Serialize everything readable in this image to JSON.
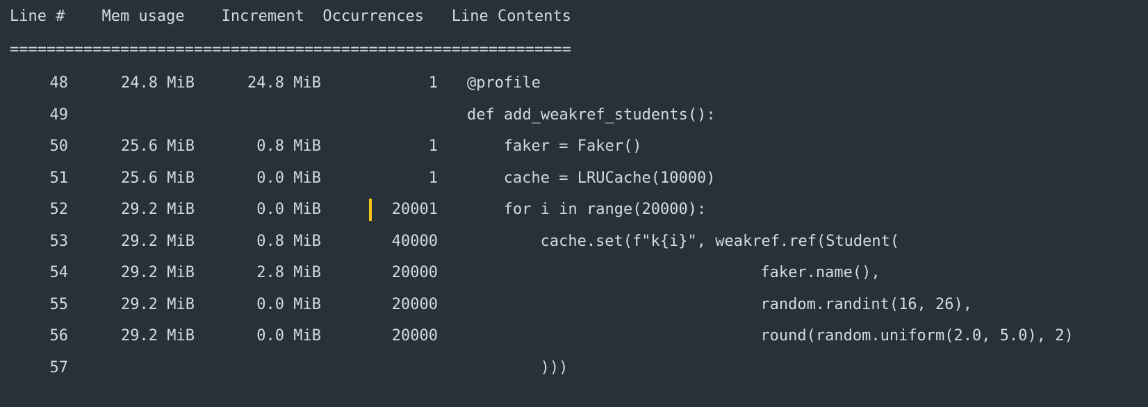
{
  "header": {
    "text": "Line #    Mem usage    Increment  Occurrences   Line Contents"
  },
  "separator": {
    "text": "============================================================="
  },
  "rows": [
    {
      "line": "48",
      "mem": "24.8 MiB",
      "inc": "24.8 MiB",
      "occ": "1",
      "code": "@profile",
      "indent": 0
    },
    {
      "line": "49",
      "mem": "",
      "inc": "",
      "occ": "",
      "code": "def add_weakref_students():",
      "indent": 0
    },
    {
      "line": "50",
      "mem": "25.6 MiB",
      "inc": "0.8 MiB",
      "occ": "1",
      "code": "faker = Faker()",
      "indent": 4
    },
    {
      "line": "51",
      "mem": "25.6 MiB",
      "inc": "0.0 MiB",
      "occ": "1",
      "code": "cache = LRUCache(10000)",
      "indent": 4
    },
    {
      "line": "52",
      "mem": "29.2 MiB",
      "inc": "0.0 MiB",
      "occ": "20001",
      "code": "for i in range(20000):",
      "indent": 4
    },
    {
      "line": "53",
      "mem": "29.2 MiB",
      "inc": "0.8 MiB",
      "occ": "40000",
      "code": "cache.set(f\"k{i}\", weakref.ref(Student(",
      "indent": 8
    },
    {
      "line": "54",
      "mem": "29.2 MiB",
      "inc": "2.8 MiB",
      "occ": "20000",
      "code": "faker.name(),",
      "indent": 32
    },
    {
      "line": "55",
      "mem": "29.2 MiB",
      "inc": "0.0 MiB",
      "occ": "20000",
      "code": "random.randint(16, 26),",
      "indent": 32
    },
    {
      "line": "56",
      "mem": "29.2 MiB",
      "inc": "0.0 MiB",
      "occ": "20000",
      "code": "round(random.uniform(2.0, 5.0), 2)",
      "indent": 32
    },
    {
      "line": "57",
      "mem": "",
      "inc": "",
      "occ": "",
      "code": ")))",
      "indent": 8
    }
  ],
  "colors": {
    "background": "#263238",
    "text": "#d3dbe0",
    "marker": "#f5c518"
  }
}
